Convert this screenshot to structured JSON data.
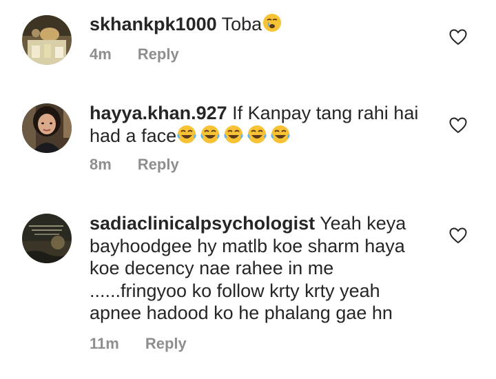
{
  "comments": [
    {
      "username": "skhankpk1000",
      "text": "Toba",
      "emoji": "crying-face",
      "time": "4m",
      "reply_label": "Reply"
    },
    {
      "username": "hayya.khan.927",
      "text": "If Kanpay tang rahi hai had a face",
      "emoji": "tears-of-joy-x5",
      "time": "8m",
      "reply_label": "Reply"
    },
    {
      "username": "sadiaclinicalpsychologist",
      "text": "Yeah keya bayhoodgee hy matlb koe sharm haya koe decency nae rahee in me ......fringyoo ko follow krty krty yeah apnee hadood ko he phalang gae hn",
      "time": "11m",
      "reply_label": "Reply"
    }
  ],
  "colors": {
    "text": "#262626",
    "meta": "#8e8e8e",
    "emoji_yellow": "#f7c234",
    "emoji_tear": "#5fb3f0"
  }
}
